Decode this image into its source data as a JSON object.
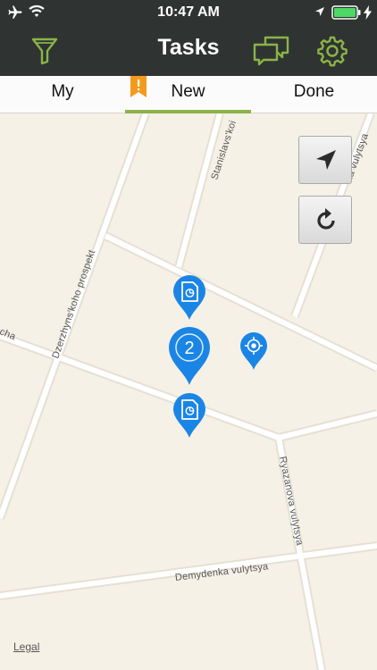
{
  "status_bar": {
    "time": "10:47 AM",
    "icons": [
      "airplane-icon",
      "wifi-icon",
      "location-arrow-icon",
      "battery-icon",
      "charging-icon"
    ]
  },
  "nav": {
    "title": "Tasks",
    "left_icon": "filter-icon",
    "right_icons": [
      "chat-icon",
      "gear-icon"
    ],
    "accent_color": "#8bb348"
  },
  "tabs": [
    {
      "label": "My",
      "active": false
    },
    {
      "label": "New",
      "active": true
    },
    {
      "label": "Done",
      "active": false
    }
  ],
  "map": {
    "street_labels": [
      "Stanislavs'koi",
      "Dzerzhyns'koho prospekt",
      "Ryazanova vulytsya",
      "Demydenka vulytsya",
      "ka vulytsya",
      "cha"
    ],
    "controls": [
      "location-arrow-button",
      "refresh-button"
    ],
    "cluster_count": "2",
    "pin_color": "#1b85e6",
    "legal": "Legal"
  }
}
